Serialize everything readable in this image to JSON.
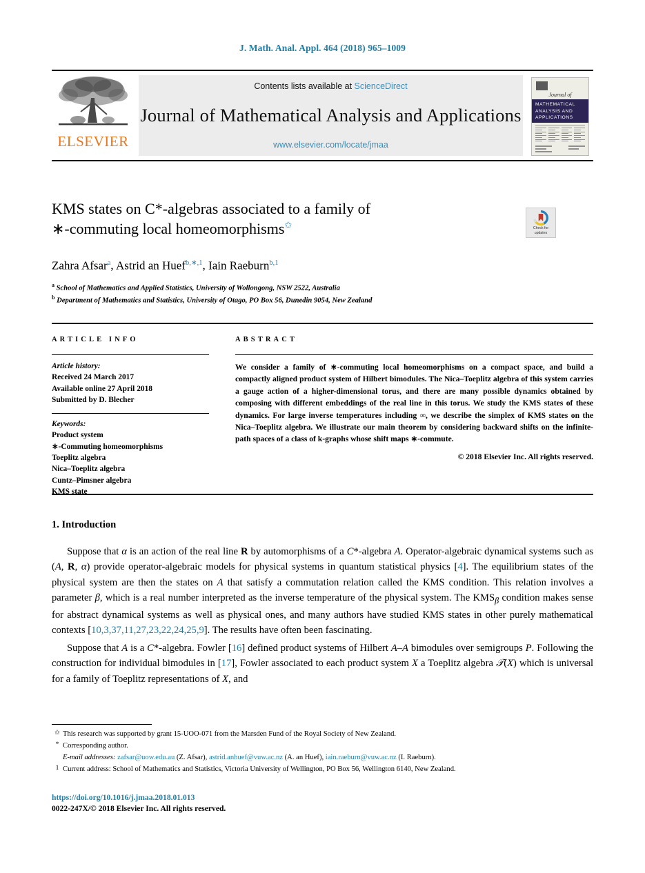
{
  "running_head": "J. Math. Anal. Appl. 464 (2018) 965–1009",
  "masthead": {
    "publisher_wordmark": "ELSEVIER",
    "contents_prefix": "Contents lists available at ",
    "contents_link": "ScienceDirect",
    "journal_title": "Journal of Mathematical Analysis and Applications",
    "journal_url": "www.elsevier.com/locate/jmaa",
    "cover": {
      "journal_of": "Journal of",
      "band_line1": "MATHEMATICAL",
      "band_line2": "ANALYSIS AND",
      "band_line3": "APPLICATIONS"
    }
  },
  "article": {
    "title_line1": "KMS states on C*-algebras associated to a family of",
    "title_line2": "∗-commuting local homeomorphisms",
    "title_footnote_marker": "✩",
    "authors_html": "Zahra Afsar<sup>a</sup>, Astrid an Huef<sup>b,∗,1</sup>, Iain Raeburn<sup>b,1</sup>",
    "affiliations": [
      {
        "marker": "a",
        "text": "School of Mathematics and Applied Statistics, University of Wollongong, NSW 2522, Australia"
      },
      {
        "marker": "b",
        "text": "Department of Mathematics and Statistics, University of Otago, PO Box 56, Dunedin 9054, New Zealand"
      }
    ]
  },
  "crossmark": {
    "line1": "Check for",
    "line2": "updates",
    "colors": {
      "blue": "#2b7fb8",
      "yellow": "#e8c52b",
      "red": "#c0392b"
    }
  },
  "article_info": {
    "heading": "ARTICLE INFO",
    "history_title": "Article history:",
    "history": [
      "Received 24 March 2017",
      "Available online 27 April 2018",
      "Submitted by D. Blecher"
    ],
    "keywords_title": "Keywords:",
    "keywords": [
      "Product system",
      "∗-Commuting homeomorphisms",
      "Toeplitz algebra",
      "Nica–Toeplitz algebra",
      "Cuntz–Pimsner algebra",
      "KMS state"
    ]
  },
  "abstract": {
    "heading": "ABSTRACT",
    "text": "We consider a family of ∗-commuting local homeomorphisms on a compact space, and build a compactly aligned product system of Hilbert bimodules. The Nica–Toeplitz algebra of this system carries a gauge action of a higher-dimensional torus, and there are many possible dynamics obtained by composing with different embeddings of the real line in this torus. We study the KMS states of these dynamics. For large inverse temperatures including ∞, we describe the simplex of KMS states on the Nica–Toeplitz algebra. We illustrate our main theorem by considering backward shifts on the infinite-path spaces of a class of k-graphs whose shift maps ∗-commute.",
    "copyright": "© 2018 Elsevier Inc. All rights reserved."
  },
  "introduction": {
    "heading": "1. Introduction",
    "paragraph1_html": "Suppose that <em class=\"math\">α</em> is an action of the real line <strong>R</strong> by automorphisms of a <em class=\"math\">C</em>*-algebra <em class=\"math\">A</em>. Operator-algebraic dynamical systems such as (<em class=\"math\">A</em>, <strong>R</strong>, <em class=\"math\">α</em>) provide operator-algebraic models for physical systems in quantum statistical physics [<span class=\"lnk\">4</span>]. The equilibrium states of the physical system are then the states on <em class=\"math\">A</em> that satisfy a commutation relation called the KMS condition. This relation involves a parameter <em class=\"math\">β</em>, which is a real number interpreted as the inverse temperature of the physical system. The KMS<sub><em class=\"math\">β</em></sub> condition makes sense for abstract dynamical systems as well as physical ones, and many authors have studied KMS states in other purely mathematical contexts [<span class=\"lnk\">10,3,37,11,27,23,22,24,25,9</span>]. The results have often been fascinating.",
    "paragraph2_html": "Suppose that <em class=\"math\">A</em> is a <em class=\"math\">C</em>*-algebra. Fowler [<span class=\"lnk\">16</span>] defined product systems of Hilbert <em class=\"math\">A</em>–<em class=\"math\">A</em> bimodules over semigroups <em class=\"math\">P</em>. Following the construction for individual bimodules in [<span class=\"lnk\">17</span>], Fowler associated to each product system <em class=\"math\">X</em> a Toeplitz algebra <em class=\"math\">𝒯</em>(<em class=\"math\">X</em>) which is universal for a family of Toeplitz representations of <em class=\"math\">X</em>, and"
  },
  "footnotes": [
    {
      "marker": "✩",
      "html": "This research was supported by grant 15-UOO-071 from the Marsden Fund of the Royal Society of New Zealand."
    },
    {
      "marker": "*",
      "html": "Corresponding author."
    },
    {
      "marker": "",
      "html": "<span class=\"ital\">E-mail addresses:</span> <span class=\"lnk\">zafsar@uow.edu.au</span> (Z. Afsar), <span class=\"lnk\">astrid.anhuef@vuw.ac.nz</span> (A. an Huef), <span class=\"lnk\">iain.raeburn@vuw.ac.nz</span> (I. Raeburn)."
    },
    {
      "marker": "1",
      "html": "Current address: School of Mathematics and Statistics, Victoria University of Wellington, PO Box 56, Wellington 6140, New Zealand."
    }
  ],
  "footer": {
    "doi": "https://doi.org/10.1016/j.jmaa.2018.01.013",
    "issn_copyright": "0022-247X/© 2018 Elsevier Inc. All rights reserved."
  }
}
